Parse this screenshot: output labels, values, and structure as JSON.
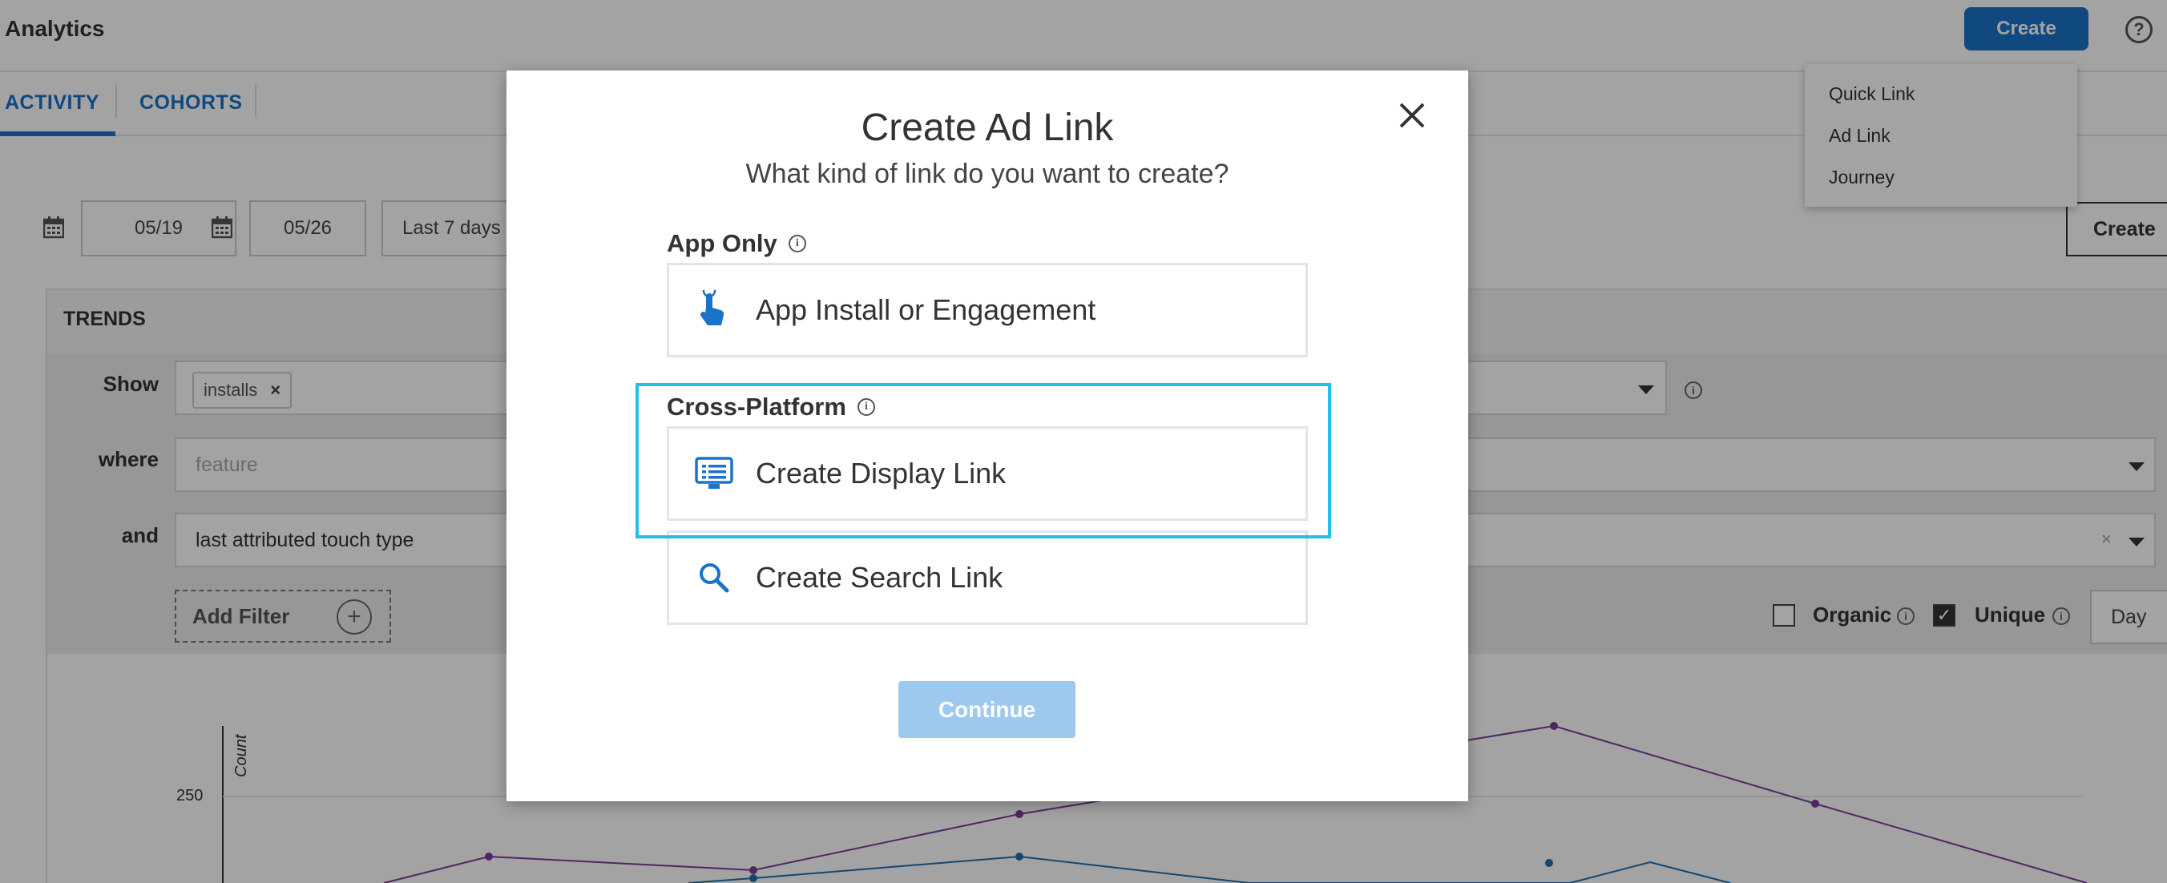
{
  "header": {
    "title": "Analytics",
    "create_label": "Create",
    "help_icon": "question-circle-icon"
  },
  "create_menu": {
    "items": [
      "Quick Link",
      "Ad Link",
      "Journey"
    ]
  },
  "tabs": [
    {
      "label": "ACTIVITY",
      "active": true
    },
    {
      "label": "COHORTS",
      "active": false
    }
  ],
  "date_range": {
    "start": "05/19",
    "end": "05/26",
    "preset": "Last 7 days",
    "calendar_icon": "calendar-icon",
    "create_right_label": "Create"
  },
  "trends": {
    "header": "TRENDS",
    "show_label": "Show",
    "show_chip": "installs",
    "where_label": "where",
    "where_placeholder": "feature",
    "and_label": "and",
    "and_value": "last attributed touch type",
    "and_clear": "×",
    "add_filter_label": "Add Filter",
    "organic_label": "Organic",
    "organic_checked": false,
    "unique_label": "Unique",
    "unique_checked": true,
    "interval": "Day"
  },
  "chart": {
    "ylabel": "Count",
    "ytick": "250",
    "series_colors": [
      "#7a3d9a",
      "#1f6fb0"
    ]
  },
  "modal": {
    "title": "Create Ad Link",
    "subtitle": "What kind of link do you want to create?",
    "app_only_label": "App Only",
    "cross_platform_label": "Cross-Platform",
    "info_glyph": "i",
    "options": [
      {
        "label": "App Install or Engagement",
        "icon": "tap-hand-icon"
      },
      {
        "label": "Create Display Link",
        "icon": "display-monitor-icon",
        "selected": true
      },
      {
        "label": "Create Search Link",
        "icon": "search-icon"
      }
    ],
    "continue_label": "Continue",
    "accent_color": "#22bfe8"
  }
}
